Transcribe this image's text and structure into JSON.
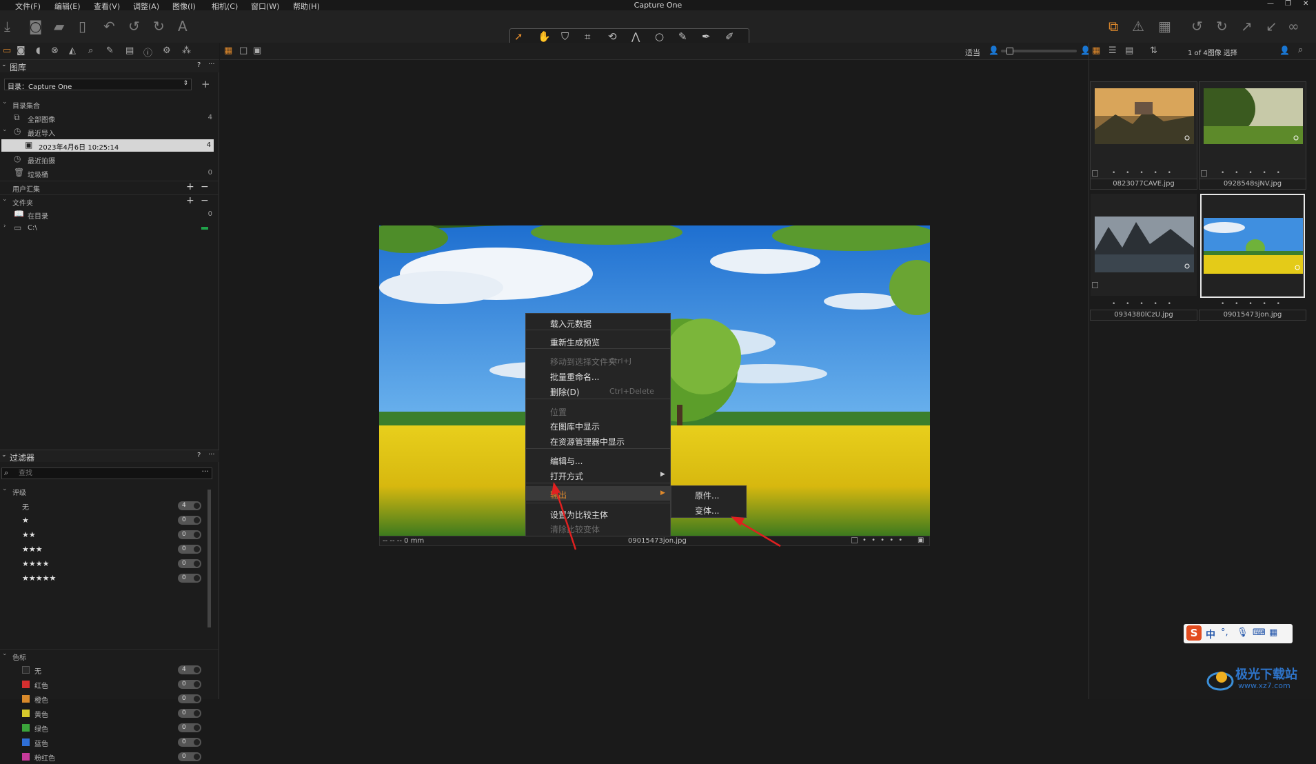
{
  "menubar": {
    "items": [
      "文件(F)",
      "编辑(E)",
      "查看(V)",
      "调整(A)",
      "图像(I)",
      "相机(C)",
      "窗口(W)",
      "帮助(H)"
    ],
    "title": "Capture One"
  },
  "viewer_bar": {
    "fit_label": "适当"
  },
  "right_bar": {
    "count_label": "1 of 4图像 选择"
  },
  "library": {
    "header": "图库",
    "help": "?",
    "more": "···",
    "catalog_label": "目录：Capture One",
    "catalog_collections": "目录集合",
    "all_images": "全部图像",
    "all_images_count": "4",
    "recent_imports": "最近导入",
    "import_date": "2023年4月6日 10:25:14",
    "import_date_count": "4",
    "recent_captures": "最近拍摄",
    "trash": "垃圾桶",
    "trash_count": "0",
    "user_collections": "用户汇集",
    "folders": "文件夹",
    "in_catalog": "在目录",
    "in_catalog_count": "0",
    "drive": "C:\\"
  },
  "filters": {
    "header": "过滤器",
    "help": "?",
    "more": "···",
    "search_placeholder": "查找",
    "rating_header": "评级",
    "ratings": [
      {
        "label": "无",
        "count": "4"
      },
      {
        "label": "★",
        "count": "0"
      },
      {
        "label": "★★",
        "count": "0"
      },
      {
        "label": "★★★",
        "count": "0"
      },
      {
        "label": "★★★★",
        "count": "0"
      },
      {
        "label": "★★★★★",
        "count": "0"
      }
    ],
    "color_header": "色标",
    "colors": [
      {
        "label": "无",
        "count": "4",
        "color": "#2a2a2a"
      },
      {
        "label": "红色",
        "count": "0",
        "color": "#d62f2f"
      },
      {
        "label": "橙色",
        "count": "0",
        "color": "#d98a2b"
      },
      {
        "label": "黄色",
        "count": "0",
        "color": "#d6c92c"
      },
      {
        "label": "绿色",
        "count": "0",
        "color": "#3ba43b"
      },
      {
        "label": "蓝色",
        "count": "0",
        "color": "#2f6fd6"
      },
      {
        "label": "粉红色",
        "count": "0",
        "color": "#c63a9a"
      }
    ]
  },
  "image": {
    "meta_left": "-- -- -- 0 mm",
    "filename": "09015473jon.jpg",
    "rating_dots": "• • • • •"
  },
  "context_menu": {
    "load_metadata": "载入元数据",
    "regen_previews": "重新生成预览",
    "move_to_selects": "移动到选择文件夹",
    "move_shortcut": "Ctrl+J",
    "batch_rename": "批量重命名...",
    "delete": "删除(D)",
    "delete_shortcut": "Ctrl+Delete",
    "location": "位置",
    "show_in_library": "在图库中显示",
    "show_in_explorer": "在资源管理器中显示",
    "edit_with": "编辑与...",
    "open_with": "打开方式",
    "export": "输出",
    "set_compare": "设置为比较主体",
    "clear_compare": "清除比较变体"
  },
  "submenu": {
    "originals": "原件...",
    "variants": "变体..."
  },
  "thumbnails": [
    {
      "name": "0823077CAVE.jpg",
      "dots": "• • • • •"
    },
    {
      "name": "0928548sjNV.jpg",
      "dots": "• • • • •"
    },
    {
      "name": "0934380lCzU.jpg",
      "dots": "• • • • •"
    },
    {
      "name": "09015473jon.jpg",
      "dots": "• • • • •"
    }
  ],
  "ime": {
    "label": "中"
  },
  "watermark": {
    "title": "极光下载站",
    "url": "www.xz7.com"
  },
  "colors": {
    "accent": "#e08a2c",
    "selection": "#d6d6d6",
    "arrow": "#e02020"
  }
}
